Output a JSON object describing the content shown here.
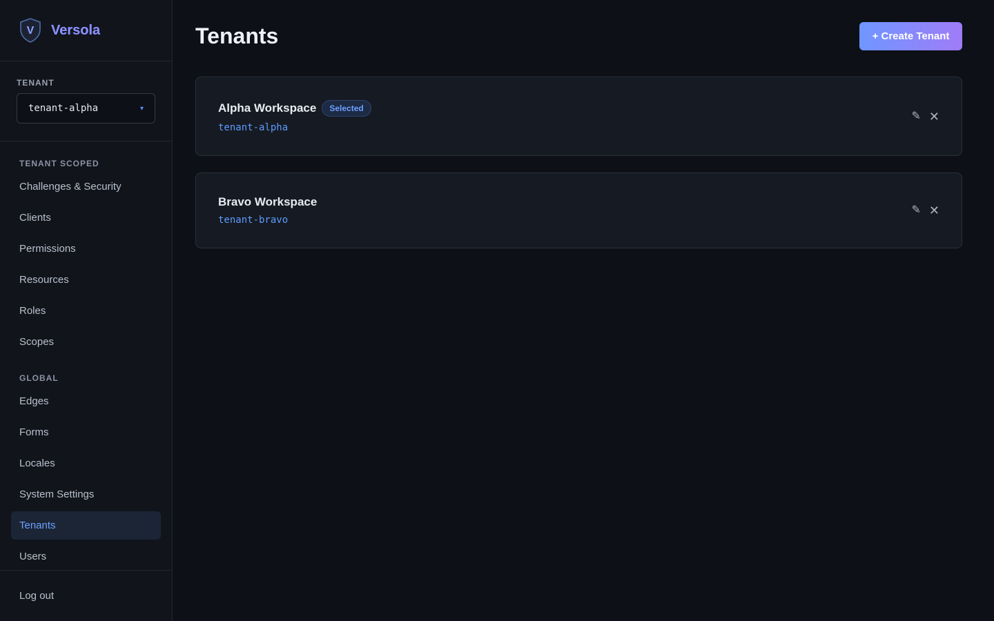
{
  "brand": {
    "logo_letter": "V",
    "name": "Versola"
  },
  "tenant_selector": {
    "label": "TENANT",
    "value": "tenant-alpha",
    "caret_icon": "▾"
  },
  "nav": {
    "groups": [
      {
        "label": "TENANT SCOPED",
        "items": [
          "Challenges & Security",
          "Clients",
          "Permissions",
          "Resources",
          "Roles",
          "Scopes"
        ]
      },
      {
        "label": "GLOBAL",
        "items": [
          "Edges",
          "Forms",
          "Locales",
          "System Settings",
          "Tenants",
          "Users"
        ]
      }
    ],
    "active_item": "Tenants"
  },
  "logout_label": "Log out",
  "page": {
    "title": "Tenants",
    "create_button": "+ Create Tenant"
  },
  "tenants": [
    {
      "name": "Alpha Workspace",
      "slug": "tenant-alpha",
      "badge": "Selected"
    },
    {
      "name": "Bravo Workspace",
      "slug": "tenant-bravo",
      "badge": ""
    }
  ],
  "icons": {
    "edit": "✎",
    "delete": "✕"
  },
  "colors": {
    "accent": "#6ea0ff",
    "background": "#0d1017",
    "sidebar": "#11141b",
    "card": "#161a22"
  }
}
